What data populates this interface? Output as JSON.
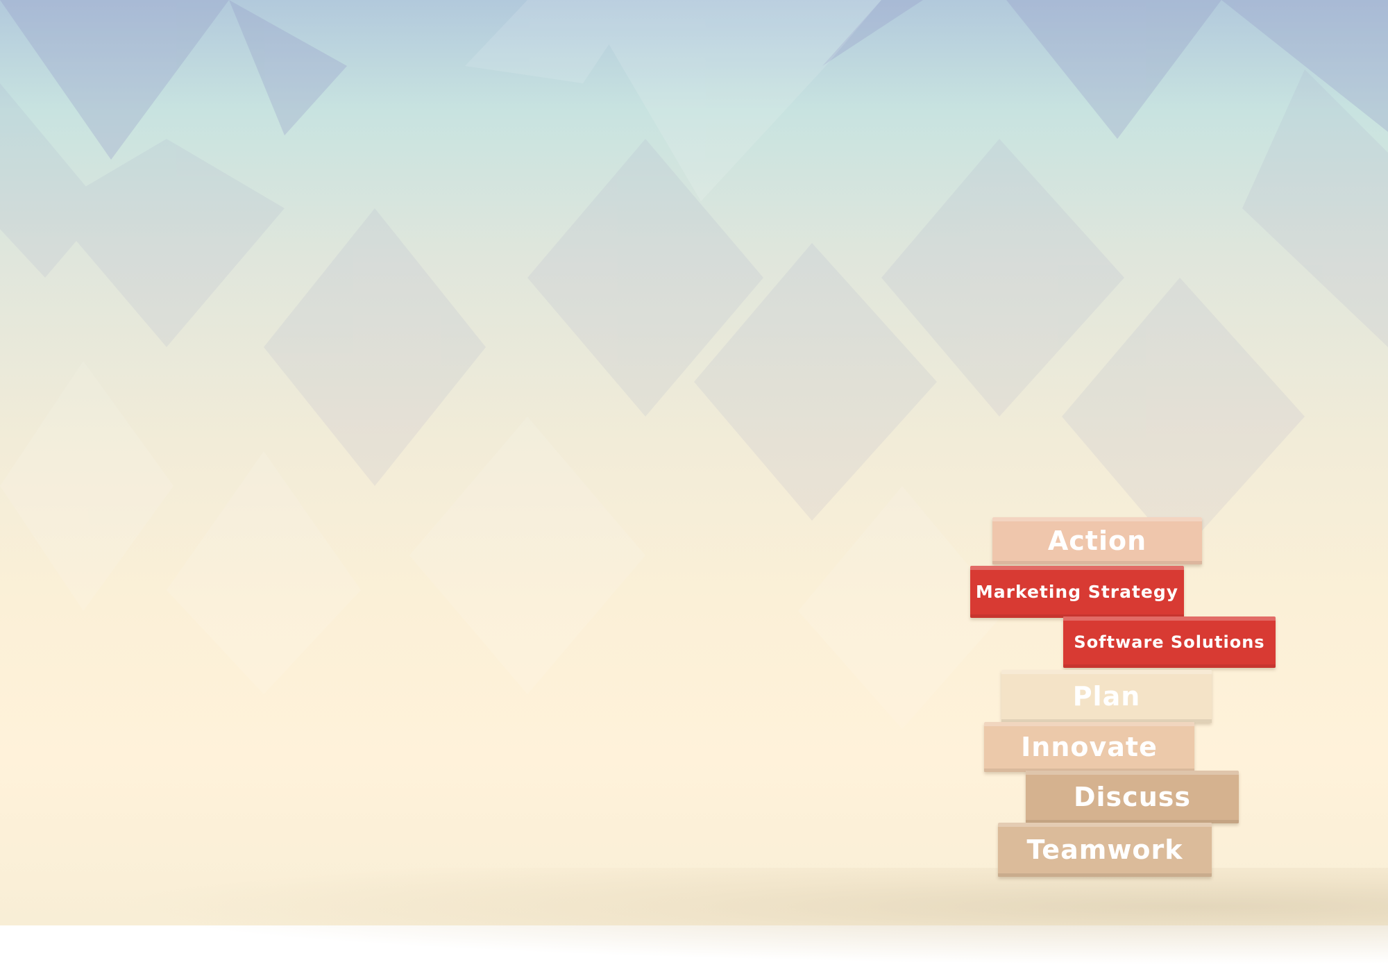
{
  "scene": {
    "colors": {
      "sky_top": "#b2c9dc",
      "mint": "#c8e3e0",
      "cream": "#fff2da",
      "block_red": "#d83a33",
      "block_peach": "#efc6ac",
      "block_light": "#f4e3c7",
      "block_tan": "#d5b28f"
    }
  },
  "blocks": [
    {
      "label": "Action"
    },
    {
      "label": "Marketing Strategy"
    },
    {
      "label": "Software Solutions"
    },
    {
      "label": "Plan"
    },
    {
      "label": "Innovate"
    },
    {
      "label": "Discuss"
    },
    {
      "label": "Teamwork"
    }
  ]
}
